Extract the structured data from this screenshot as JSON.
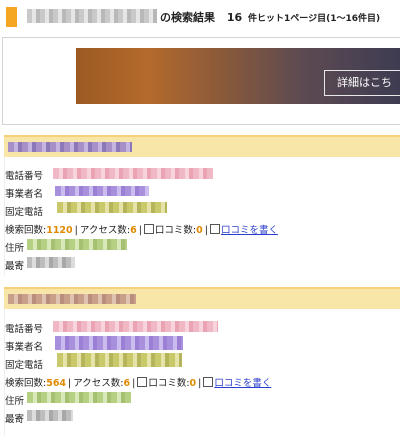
{
  "header": {
    "suffix_label": "の検索結果",
    "hit_count": "16",
    "hit_text": "件ヒット1ページ目(1〜16件目)"
  },
  "banner": {
    "detail_button": "詳細はこち"
  },
  "listings": [
    {
      "phone_label": "電話番号",
      "owner_label": "事業者名",
      "landline_label": "固定電話",
      "search_label": "検索回数:",
      "search_count": "1120",
      "access_label": "アクセス数:",
      "access_count": "6",
      "review_label": "口コミ数:",
      "review_count": "0",
      "write_review": "口コミを書く",
      "address_label": "住所",
      "nearest_label": "最寄"
    },
    {
      "phone_label": "電話番号",
      "owner_label": "事業者名",
      "landline_label": "固定電話",
      "search_label": "検索回数:",
      "search_count": "564",
      "access_label": "アクセス数:",
      "access_count": "6",
      "review_label": "口コミ数:",
      "review_count": "0",
      "write_review": "口コミを書く",
      "address_label": "住所",
      "nearest_label": "最寄"
    }
  ]
}
